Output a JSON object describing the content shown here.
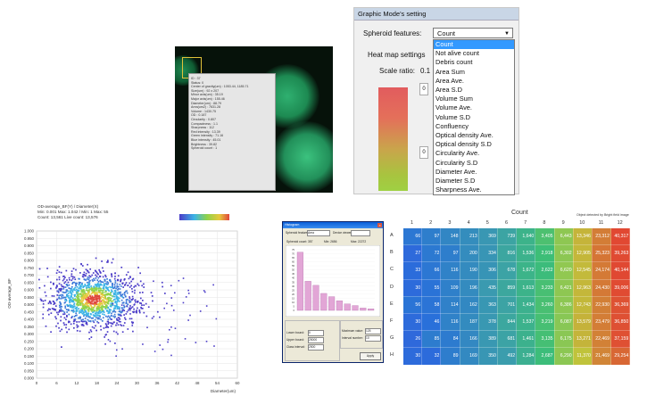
{
  "microscope": {
    "tooltip_lines": [
      "ID : 37",
      "Status: 0",
      "Center of gravity(um) : 1053.44, 1185.71",
      "Size(um) : 92 x 207",
      "Minor axis(um) : 35.19",
      "Major axis(um) : 155.46",
      "Diameter(um) : 88.79",
      "Area(um2) : 7631.28",
      "Volume : 1430.75",
      "OD : 0.187",
      "Circularity : 0.807",
      "Compactness : 1.1",
      "Sharpness : 112",
      "Red intensity : 13.39",
      "Green intensity : 71.16",
      "Blue intensity : 45.01",
      "Brightness : 39.82",
      "Spheroid count : 1"
    ]
  },
  "settings": {
    "title": "Graphic Mode's setting",
    "spheroid_label": "Spheroid features:",
    "selected": "Count",
    "options": [
      "Count",
      "Not alive count",
      "Debris count",
      "Area Sum",
      "Area Ave.",
      "Area S.D",
      "Volume Sum",
      "Volume Ave.",
      "Volume S.D",
      "Confluency",
      "Optical density Ave.",
      "Optical density S.D",
      "Circularity Ave.",
      "Circularity S.D",
      "Diameter Ave.",
      "Diameter S.D",
      "Sharpness Ave."
    ],
    "heatmap_label": "Heat map settings",
    "scale_label": "Scale ratio:",
    "scale_value": "0.1",
    "box_values": [
      "0",
      "0"
    ]
  },
  "scatter": {
    "title_lines": [
      "OD-average_BF(Y) / Diameter(X)",
      "Min: 0.001 Max: 1.042 / Min: 1 Max: 55",
      "Count: 13,561 Live count: 13,576"
    ],
    "ylabel": "OD-average_BF",
    "xlabel": "Diameter(um)",
    "yticks": [
      "1.000",
      "0.950",
      "0.900",
      "0.850",
      "0.800",
      "0.750",
      "0.700",
      "0.650",
      "0.600",
      "0.550",
      "0.500",
      "0.450",
      "0.400",
      "0.350",
      "0.300",
      "0.250",
      "0.200",
      "0.150",
      "0.100",
      "0.050",
      "0.000"
    ],
    "xticks": [
      "0",
      "6",
      "12",
      "18",
      "24",
      "30",
      "36",
      "42",
      "48",
      "54",
      "60"
    ]
  },
  "dialog": {
    "title": "Histogram",
    "feature_label": "Spheroid features:",
    "feature_value": "Area",
    "sort_label": "Device viewer",
    "stats": [
      "Spheroid count: 357",
      "Min: 2656",
      "Max: 22272"
    ],
    "bars": [
      72,
      36,
      31,
      21,
      17,
      12,
      8,
      6,
      3,
      2
    ],
    "yticks": [
      "75",
      "70",
      "65",
      "60",
      "55",
      "50",
      "45",
      "40",
      "35",
      "30",
      "25",
      "20",
      "15",
      "10",
      "5",
      "0"
    ],
    "button": "Apply",
    "fields": [
      "Lower bound:",
      "Upper bound:",
      "Class interval:",
      "Maximum value:",
      "Interval number:"
    ],
    "field_values": [
      "0",
      "25000",
      "2500",
      "125",
      "10"
    ]
  },
  "plate": {
    "title": "Count",
    "note": "Object detected by Bright field image",
    "cols": [
      "1",
      "2",
      "3",
      "4",
      "5",
      "6",
      "7",
      "8",
      "9",
      "10",
      "11",
      "12"
    ],
    "rows": [
      "A",
      "B",
      "C",
      "D",
      "E",
      "F",
      "G",
      "H"
    ],
    "values": [
      [
        "66",
        "97",
        "148",
        "213",
        "369",
        "739",
        "1,640",
        "3,405",
        "6,443",
        "13,346",
        "23,312",
        "40,317"
      ],
      [
        "27",
        "72",
        "97",
        "200",
        "334",
        "816",
        "1,536",
        "2,918",
        "6,302",
        "12,905",
        "25,323",
        "39,263"
      ],
      [
        "33",
        "66",
        "116",
        "190",
        "306",
        "678",
        "1,672",
        "2,622",
        "6,620",
        "12,545",
        "24,174",
        "40,144"
      ],
      [
        "30",
        "55",
        "109",
        "196",
        "435",
        "859",
        "1,613",
        "3,233",
        "6,421",
        "12,963",
        "24,430",
        "39,006"
      ],
      [
        "56",
        "58",
        "114",
        "162",
        "363",
        "701",
        "1,434",
        "3,260",
        "6,386",
        "12,743",
        "22,930",
        "36,369"
      ],
      [
        "30",
        "46",
        "116",
        "187",
        "378",
        "844",
        "1,537",
        "3,219",
        "6,087",
        "13,579",
        "23,479",
        "36,850"
      ],
      [
        "26",
        "85",
        "84",
        "166",
        "389",
        "681",
        "1,461",
        "3,135",
        "6,175",
        "13,271",
        "22,469",
        "37,159"
      ],
      [
        "30",
        "32",
        "89",
        "169",
        "350",
        "492",
        "1,284",
        "2,687",
        "6,290",
        "11,370",
        "21,469",
        "29,254"
      ]
    ]
  }
}
